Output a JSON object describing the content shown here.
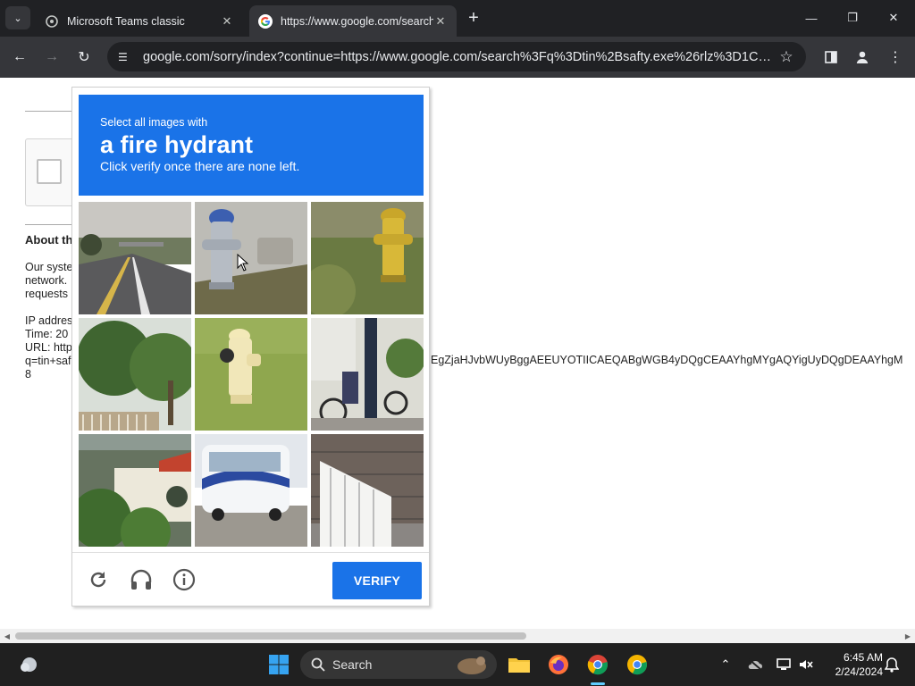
{
  "browser": {
    "tabs": [
      {
        "title": "Microsoft Teams classic",
        "active": false
      },
      {
        "title": "https://www.google.com/search",
        "active": true
      }
    ],
    "new_tab_label": "+",
    "address": "google.com/sorry/index?continue=https://www.google.com/search%3Fq%3Dtin%2Bsafty.exe%26rlz%3D1C1GCE..."
  },
  "page": {
    "about_heading": "About th",
    "paragraph_lines": [
      "Our syste",
      "network.",
      "requests"
    ],
    "info_lines": [
      "IP addres",
      "Time: 20",
      "URL: http",
      "q=tin+saf",
      "8"
    ],
    "url_continuation": "EgZjaHJvbWUyBggAEEUYOTIICAEQABgWGB4yDQgCEAAYhgMYgAQYigUyDQgDEAAYhgM"
  },
  "captcha": {
    "instruction_line1": "Select all images with",
    "target_object": "a fire hydrant",
    "instruction_line3": "Click verify once there are none left.",
    "verify_label": "VERIFY",
    "tiles": [
      "road",
      "blue-top-hydrant",
      "yellow-hydrant",
      "trees",
      "white-hydrant",
      "bicycles",
      "house",
      "bus",
      "stair-railing"
    ]
  },
  "taskbar": {
    "search_placeholder": "Search",
    "time": "6:45 AM",
    "date": "2/24/2024"
  },
  "colors": {
    "captcha_blue": "#1a73e8",
    "chrome_dark": "#202124",
    "chrome_toolbar": "#35363a"
  }
}
